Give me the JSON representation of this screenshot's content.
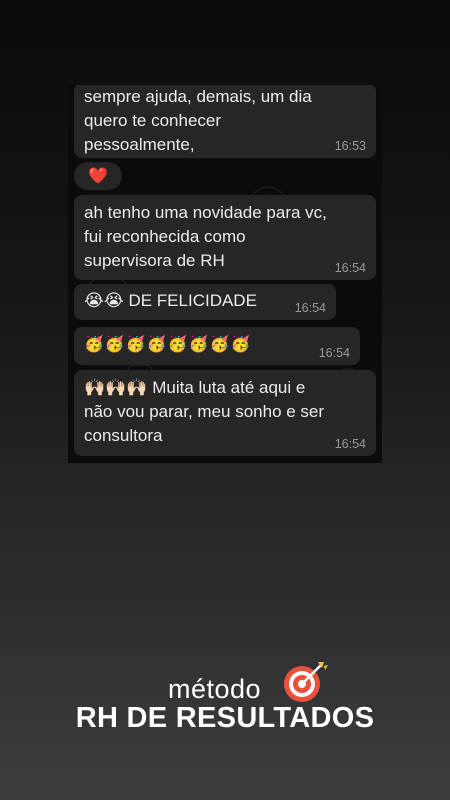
{
  "messages": [
    {
      "text": "sempre ajuda, demais, um dia\nquero te conhecer\npessoalmente,",
      "time": "16:53"
    },
    {
      "reaction": "❤️"
    },
    {
      "text": "ah tenho uma novidade para vc,\nfui reconhecida como\nsupervisora de RH",
      "time": "16:54"
    },
    {
      "text": "😭😭 DE FELICIDADE",
      "time": "16:54"
    },
    {
      "text": "🥳🥳🥳🥳🥳🥳🥳🥳",
      "time": "16:54"
    },
    {
      "text": "🙌🏻🙌🏻🙌🏻 Muita luta até aqui e\nnão vou parar, meu sonho e ser\nconsultora",
      "time": "16:54"
    }
  ],
  "brand": {
    "line1": "método",
    "line2": "RH DE RESULTADOS",
    "icon": "target-icon",
    "accent_color": "#e8523a"
  }
}
